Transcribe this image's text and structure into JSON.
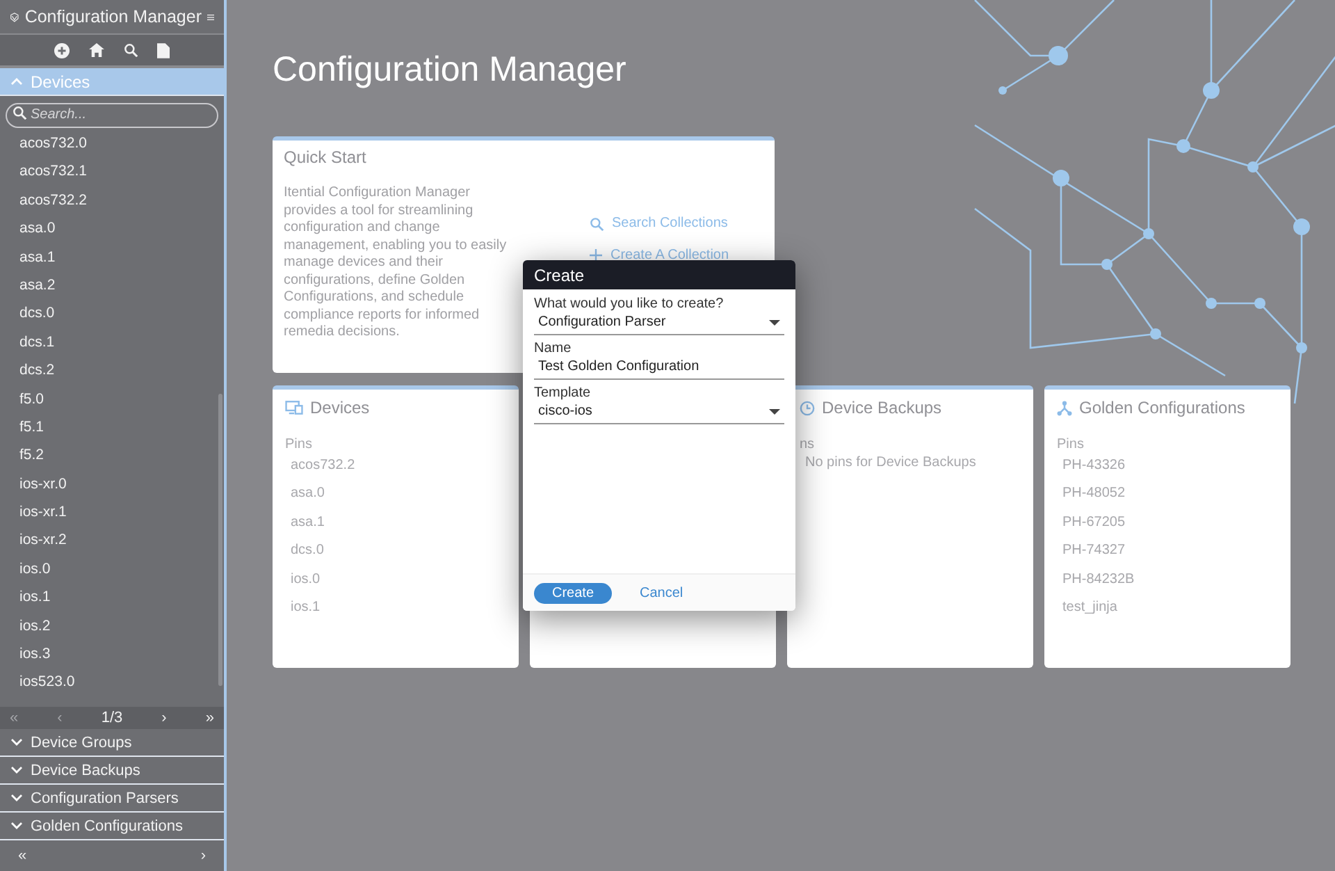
{
  "sidebar": {
    "title": "Configuration Manager",
    "sections": [
      {
        "label": "Devices",
        "expanded": true,
        "search_placeholder": "Search...",
        "items": [
          "acos732.0",
          "acos732.1",
          "acos732.2",
          "asa.0",
          "asa.1",
          "asa.2",
          "dcs.0",
          "dcs.1",
          "dcs.2",
          "f5.0",
          "f5.1",
          "f5.2",
          "ios-xr.0",
          "ios-xr.1",
          "ios-xr.2",
          "ios.0",
          "ios.1",
          "ios.2",
          "ios.3",
          "ios523.0"
        ],
        "pager": {
          "first": "«",
          "prev": "‹",
          "page": "1/3",
          "next": "›",
          "last": "»"
        }
      },
      {
        "label": "Device Groups",
        "expanded": false
      },
      {
        "label": "Device Backups",
        "expanded": false
      },
      {
        "label": "Configuration Parsers",
        "expanded": false
      },
      {
        "label": "Golden Configurations",
        "expanded": false
      }
    ],
    "footer": {
      "collapse": "«",
      "next": "›"
    }
  },
  "page_title": "Configuration Manager",
  "quick_start": {
    "title": "Quick Start",
    "description": "Itential Configuration Manager provides a tool for streamlining configuration and change management, enabling you to easily manage devices and their configurations, define Golden Configurations, and schedule compliance reports for informed remedia decisions.",
    "links": [
      {
        "kind": "search",
        "label": "Search Collections"
      },
      {
        "kind": "create",
        "label": "Create A Collection"
      }
    ]
  },
  "cards": [
    {
      "kind": "devices",
      "title": "Devices",
      "pins_label": "Pins",
      "pins": [
        "acos732.2",
        "asa.0",
        "asa.1",
        "dcs.0",
        "ios.0",
        "ios.1"
      ]
    },
    {
      "kind": "covered"
    },
    {
      "kind": "backups",
      "title": "Device Backups",
      "pins_label": "ns",
      "empty_text": "No pins for Device Backups"
    },
    {
      "kind": "golden",
      "title": "Golden Configurations",
      "pins_label": "Pins",
      "pins": [
        "PH-43326",
        "PH-48052",
        "PH-67205",
        "PH-74327",
        "PH-84232B",
        "test_jinja"
      ]
    }
  ],
  "dialog": {
    "title": "Create",
    "fields": [
      {
        "kind": "select",
        "label": "What would you like to create?",
        "value": "Configuration Parser"
      },
      {
        "kind": "text",
        "label": "Name",
        "value": "Test Golden Configuration"
      },
      {
        "kind": "select",
        "label": "Template",
        "value": "cisco-ios"
      }
    ],
    "buttons": [
      {
        "kind": "primary",
        "label": "Create"
      },
      {
        "kind": "link",
        "label": "Cancel"
      }
    ]
  }
}
